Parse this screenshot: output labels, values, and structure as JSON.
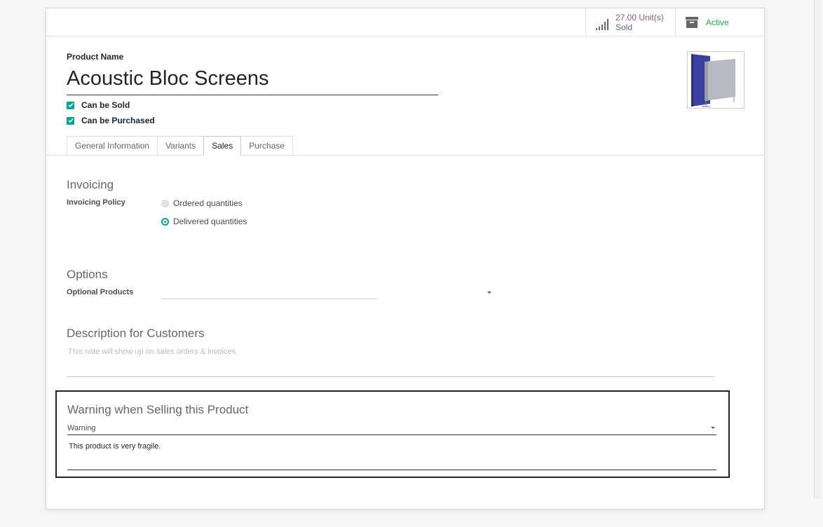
{
  "stat_buttons": {
    "sold": {
      "value": "27.00 Unit(s)",
      "label": "Sold",
      "icon": "signal-bars-icon"
    },
    "active": {
      "label": "Active",
      "icon": "archive-box-icon"
    }
  },
  "product": {
    "name_label": "Product Name",
    "name": "Acoustic Bloc Screens",
    "can_be_sold": {
      "label": "Can be Sold",
      "checked": true
    },
    "can_be_purchased": {
      "label": "Can be Purchased",
      "checked": true
    }
  },
  "tabs": [
    {
      "label": "General Information",
      "active": false
    },
    {
      "label": "Variants",
      "active": false
    },
    {
      "label": "Sales",
      "active": true
    },
    {
      "label": "Purchase",
      "active": false
    }
  ],
  "invoicing": {
    "title": "Invoicing",
    "policy_label": "Invoicing Policy",
    "options": [
      {
        "label": "Ordered quantities",
        "selected": false
      },
      {
        "label": "Delivered quantities",
        "selected": true
      }
    ]
  },
  "options": {
    "title": "Options",
    "optional_products_label": "Optional Products",
    "optional_products_value": ""
  },
  "description": {
    "title": "Description for Customers",
    "placeholder": "This note will show up on sales orders & invoices."
  },
  "warning": {
    "title": "Warning when Selling this Product",
    "selected": "Warning",
    "message": "This product is very fragile."
  },
  "colors": {
    "accent": "#00a09d",
    "stat_value": "#875a7b",
    "active_green": "#28a745"
  }
}
